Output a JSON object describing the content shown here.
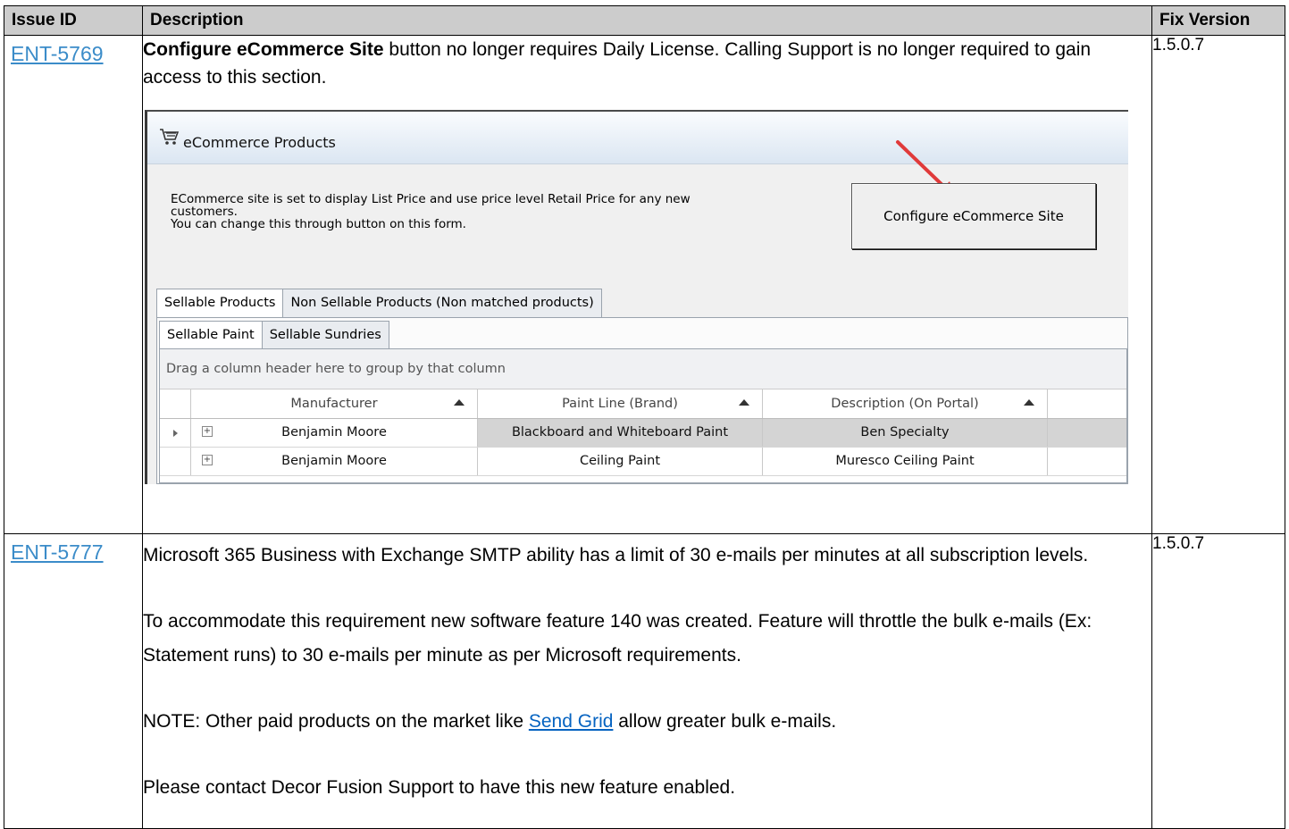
{
  "table": {
    "headers": [
      "Issue ID",
      "Description",
      "Fix Version"
    ],
    "rows": [
      {
        "issue_id": "ENT-5769",
        "desc_bold": "Configure eCommerce Site",
        "desc_rest": " button no longer requires Daily License.  Calling Support is no longer required to gain access to this section.",
        "fix_version": "1.5.0.7"
      },
      {
        "issue_id": "ENT-5777",
        "p1": "Microsoft 365 Business with Exchange SMTP ability has a limit of 30 e-mails per minutes at all subscription levels.",
        "p2": "To accommodate this requirement new software feature 140 was created.  Feature will throttle the bulk e-mails (Ex: Statement runs) to 30 e-mails per minute as per Microsoft requirements.",
        "p3_pre": "NOTE: Other paid products on the market like ",
        "p3_link": "Send Grid",
        "p3_post": " allow greater bulk e-mails.",
        "p4": "Please contact Decor Fusion Support to have this new feature enabled.",
        "fix_version": "1.5.0.7"
      }
    ]
  },
  "screenshot": {
    "window_title": "eCommerce Products",
    "message_lines": [
      "ECommerce site is set to display List Price and use price level Retail Price for any new",
      "customers.",
      "You can change this through button on this form."
    ],
    "configure_button": "Configure eCommerce Site",
    "outer_tabs": [
      "Sellable Products",
      "Non Sellable Products (Non matched products)"
    ],
    "inner_tabs": [
      "Sellable Paint",
      "Sellable Sundries"
    ],
    "group_hint": "Drag a column header here to group by that column",
    "columns": [
      "Manufacturer",
      "Paint Line (Brand)",
      "Description (On Portal)"
    ],
    "rows": [
      [
        "Benjamin Moore",
        "Blackboard and Whiteboard Paint",
        "Ben Specialty"
      ],
      [
        "Benjamin Moore",
        "Ceiling Paint",
        "Muresco Ceiling Paint"
      ]
    ]
  },
  "icons": {
    "cart": "cart-icon",
    "arrow": "red-arrow-icon",
    "expand": "expand-plus-icon"
  },
  "colors": {
    "id_link": "#3b8cc9",
    "header_bg": "#cccccc",
    "hyperlink": "#0563c1",
    "arrow": "#e03a3a"
  }
}
